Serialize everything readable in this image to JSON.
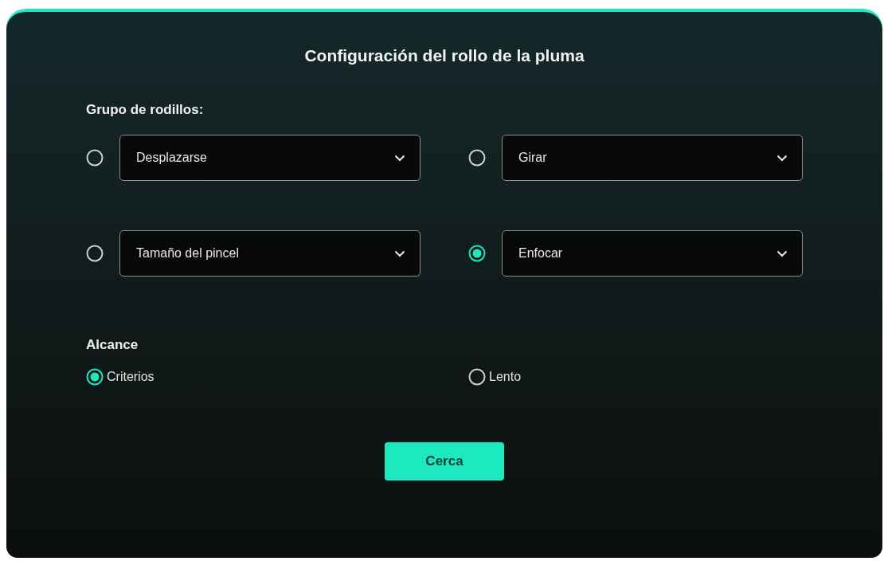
{
  "dialog": {
    "title": "Configuración del rollo de la pluma"
  },
  "roller_group": {
    "label": "Grupo de rodillos:",
    "options": [
      {
        "value": "Desplazarse",
        "selected": false
      },
      {
        "value": "Girar",
        "selected": false
      },
      {
        "value": "Tamaño del pincel",
        "selected": false
      },
      {
        "value": "Enfocar",
        "selected": true
      }
    ]
  },
  "scope": {
    "label": "Alcance",
    "options": [
      {
        "label": "Criterios",
        "selected": true
      },
      {
        "label": "Lento",
        "selected": false
      }
    ]
  },
  "buttons": [
    {
      "label": "Cerca"
    }
  ]
}
